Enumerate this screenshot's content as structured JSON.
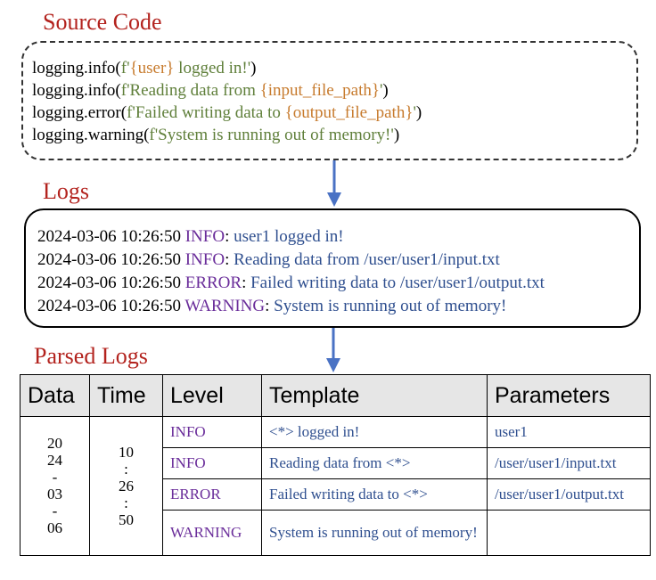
{
  "titles": {
    "source_code": "Source Code",
    "logs": "Logs",
    "parsed_logs": "Parsed Logs"
  },
  "source_code": {
    "line1": {
      "prefix": "logging.info(",
      "fmt_open": "f'",
      "ph1": "{user}",
      "text1": " logged in!'",
      "suffix": ")"
    },
    "line2": {
      "prefix": "logging.info(",
      "fmt_open": "f'Reading data from ",
      "ph1": "{input_file_path}",
      "text1": "'",
      "suffix": ")"
    },
    "line3": {
      "prefix": "logging.error(",
      "fmt_open": "f'Failed writing data to ",
      "ph1": "{output_file_path}",
      "text1": "'",
      "suffix": ")"
    },
    "line4": {
      "prefix": "logging.warning(",
      "fmt_open": "f'System is running out of memory!'",
      "suffix": ")"
    }
  },
  "logs": [
    {
      "timestamp": "2024-03-06 10:26:50 ",
      "level": "INFO",
      "sep": ": ",
      "message": "user1 logged in!"
    },
    {
      "timestamp": "2024-03-06 10:26:50 ",
      "level": "INFO",
      "sep": ": ",
      "message": "Reading data from /user/user1/input.txt"
    },
    {
      "timestamp": "2024-03-06 10:26:50 ",
      "level": "ERROR",
      "sep": ": ",
      "message": "Failed writing data to /user/user1/output.txt"
    },
    {
      "timestamp": "2024-03-06 10:26:50 ",
      "level": "WARNING",
      "sep": ": ",
      "message": "System is running out of memory!"
    }
  ],
  "table": {
    "headers": {
      "data": "Data",
      "time": "Time",
      "level": "Level",
      "template": "Template",
      "parameters": "Parameters"
    },
    "date_parts": [
      "20",
      "24",
      "-",
      "03",
      "-",
      "06"
    ],
    "time_parts": [
      "10",
      ":",
      "26",
      ":",
      "50"
    ],
    "rows": [
      {
        "level": "INFO",
        "template": "<*> logged in!",
        "parameters": "user1"
      },
      {
        "level": "INFO",
        "template": "Reading data from <*>",
        "parameters": "/user/user1/input.txt"
      },
      {
        "level": "ERROR",
        "template": "Failed writing data to <*>",
        "parameters": "/user/user1/output.txt"
      },
      {
        "level": "WARNING",
        "template": "System is running out of memory!",
        "parameters": ""
      }
    ]
  },
  "colors": {
    "title": "#b3231e",
    "format_string": "#5f7f3a",
    "placeholder": "#c77b2e",
    "level": "#6a2d9a",
    "message": "#2f4f8f",
    "arrow": "#4a72c4"
  }
}
